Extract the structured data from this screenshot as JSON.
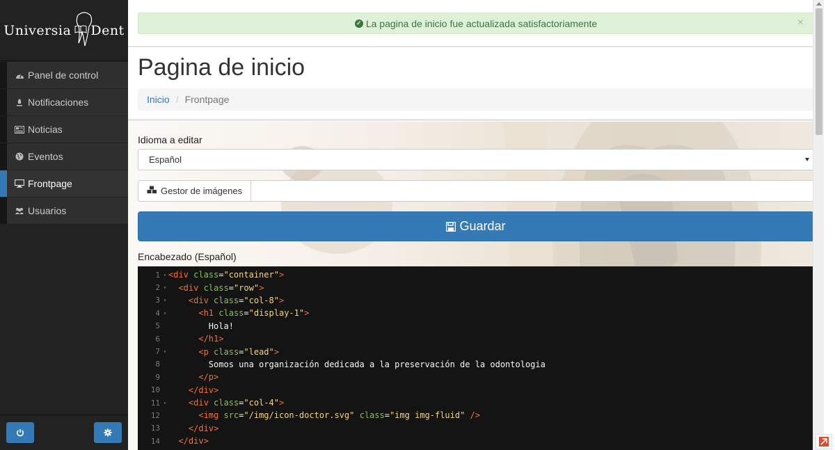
{
  "sidebar": {
    "logo": {
      "left": "Universia",
      "right": "Dent"
    },
    "items": [
      {
        "label": "Panel de control",
        "icon": "dashboard-icon",
        "active": false
      },
      {
        "label": "Notificaciones",
        "icon": "bell-icon",
        "active": false
      },
      {
        "label": "Noticias",
        "icon": "newspaper-icon",
        "active": false
      },
      {
        "label": "Eventos",
        "icon": "globe-icon",
        "active": false
      },
      {
        "label": "Frontpage",
        "icon": "desktop-icon",
        "active": true
      },
      {
        "label": "Usuarios",
        "icon": "users-icon",
        "active": false
      }
    ],
    "footer": {
      "power_icon": "power-icon",
      "settings_icon": "gear-icon"
    }
  },
  "alert": {
    "text": "La pagina de inicio fue actualizada satisfactoriamente",
    "close": "×",
    "color": "#3c763d"
  },
  "page": {
    "title": "Pagina de inicio",
    "breadcrumb": {
      "home": "Inicio",
      "separator": "/",
      "current": "Frontpage"
    }
  },
  "form": {
    "language_label": "Idioma a editar",
    "language_value": "Español",
    "image_manager_label": "Gestor de imágenes",
    "save_label": "Guardar",
    "header_label": "Encabezado (Español)"
  },
  "editor": {
    "lines": [
      {
        "n": "1",
        "fold": "▾",
        "indent": "",
        "parts": [
          [
            "tg",
            "<div "
          ],
          [
            "at",
            "class"
          ],
          [
            "tx",
            "="
          ],
          [
            "st",
            "\"container\""
          ],
          [
            "tg",
            ">"
          ]
        ]
      },
      {
        "n": "2",
        "fold": "▾",
        "indent": "  ",
        "parts": [
          [
            "tg",
            "<div "
          ],
          [
            "at",
            "class"
          ],
          [
            "tx",
            "="
          ],
          [
            "st",
            "\"row\""
          ],
          [
            "tg",
            ">"
          ]
        ]
      },
      {
        "n": "3",
        "fold": "▾",
        "indent": "    ",
        "parts": [
          [
            "tg",
            "<div "
          ],
          [
            "at",
            "class"
          ],
          [
            "tx",
            "="
          ],
          [
            "st",
            "\"col-8\""
          ],
          [
            "tg",
            ">"
          ]
        ]
      },
      {
        "n": "4",
        "fold": "▾",
        "indent": "      ",
        "parts": [
          [
            "tg",
            "<h1 "
          ],
          [
            "at",
            "class"
          ],
          [
            "tx",
            "="
          ],
          [
            "st",
            "\"display-1\""
          ],
          [
            "tg",
            ">"
          ]
        ]
      },
      {
        "n": "5",
        "fold": "",
        "indent": "        ",
        "parts": [
          [
            "tx",
            "Hola!"
          ]
        ]
      },
      {
        "n": "6",
        "fold": "",
        "indent": "      ",
        "parts": [
          [
            "tg",
            "</h1>"
          ]
        ]
      },
      {
        "n": "7",
        "fold": "▾",
        "indent": "      ",
        "parts": [
          [
            "tg",
            "<p "
          ],
          [
            "at",
            "class"
          ],
          [
            "tx",
            "="
          ],
          [
            "st",
            "\"lead\""
          ],
          [
            "tg",
            ">"
          ]
        ]
      },
      {
        "n": "8",
        "fold": "",
        "indent": "        ",
        "parts": [
          [
            "tx",
            "Somos una organización dedicada a la preservación de la odontologia"
          ]
        ]
      },
      {
        "n": "9",
        "fold": "",
        "indent": "      ",
        "parts": [
          [
            "tg",
            "</p>"
          ]
        ]
      },
      {
        "n": "10",
        "fold": "",
        "indent": "    ",
        "parts": [
          [
            "tg",
            "</div>"
          ]
        ]
      },
      {
        "n": "11",
        "fold": "▾",
        "indent": "    ",
        "parts": [
          [
            "tg",
            "<div "
          ],
          [
            "at",
            "class"
          ],
          [
            "tx",
            "="
          ],
          [
            "st",
            "\"col-4\""
          ],
          [
            "tg",
            ">"
          ]
        ]
      },
      {
        "n": "12",
        "fold": "",
        "indent": "      ",
        "parts": [
          [
            "tg",
            "<img "
          ],
          [
            "at",
            "src"
          ],
          [
            "tx",
            "="
          ],
          [
            "st",
            "\"/img/icon-doctor.svg\""
          ],
          [
            "tx",
            " "
          ],
          [
            "at",
            "class"
          ],
          [
            "tx",
            "="
          ],
          [
            "st",
            "\"img img-fluid\""
          ],
          [
            "tg",
            " />"
          ]
        ]
      },
      {
        "n": "13",
        "fold": "",
        "indent": "    ",
        "parts": [
          [
            "tg",
            "</div>"
          ]
        ]
      },
      {
        "n": "14",
        "fold": "",
        "indent": "  ",
        "parts": [
          [
            "tg",
            "</div>"
          ]
        ]
      }
    ]
  },
  "colors": {
    "primary": "#337ab7",
    "sidebar_bg": "#222222",
    "editor_bg": "#141414",
    "success_bg": "#dff0d8"
  }
}
